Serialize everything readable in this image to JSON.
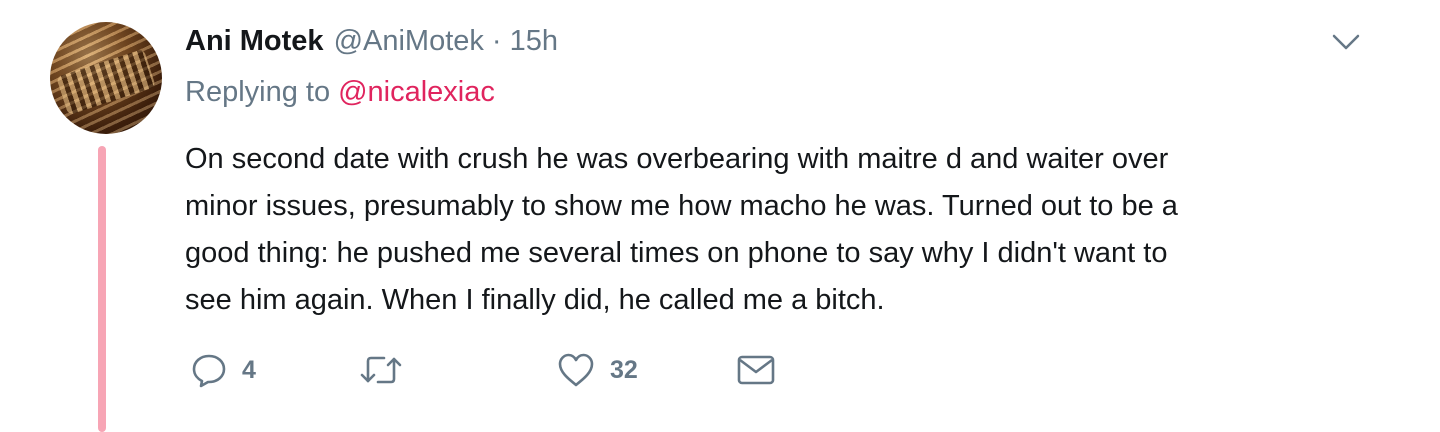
{
  "tweet": {
    "author_name": "Ani Motek",
    "author_handle": "@AniMotek",
    "separator": "·",
    "time": "15h",
    "replying_prefix": "Replying to",
    "replying_mention": "@nicalexiac",
    "text": "On second date with crush he was overbearing with maitre d and waiter over\nminor issues, presumably to show me how macho he was. Turned out to be a\ngood thing: he pushed me several times on phone to say why I didn't want to\nsee him again. When I finally did, he called me a bitch."
  },
  "actions": {
    "reply_count": "4",
    "retweet_count": "",
    "like_count": "32"
  },
  "colors": {
    "text": "#14171a",
    "muted": "#657786",
    "mention": "#e0245e",
    "thread_line": "#f7a5b5"
  },
  "icons": [
    "avatar-image",
    "chevron-down-icon",
    "reply-icon",
    "retweet-icon",
    "heart-icon",
    "mail-icon"
  ]
}
